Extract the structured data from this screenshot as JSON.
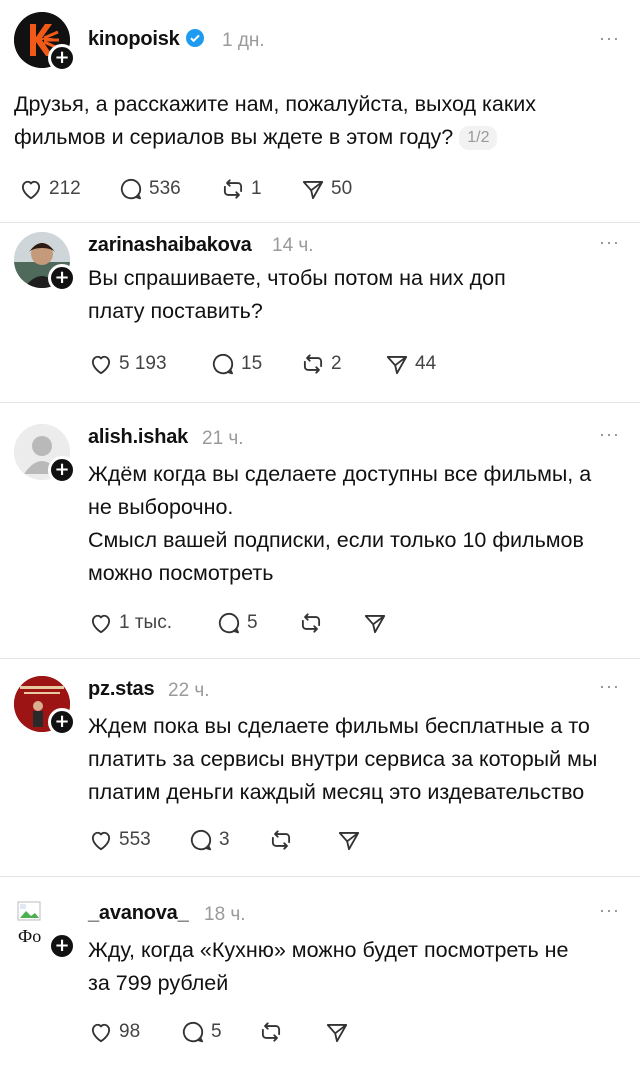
{
  "posts": [
    {
      "username": "kinopoisk",
      "verified": true,
      "time": "1 дн.",
      "text": "Друзья, а расскажите нам, пожалуйста, выход каких\nфильмов и сериалов вы ждете в этом году?",
      "pager": "1/2",
      "likes": "212",
      "replies": "536",
      "reposts": "1",
      "shares": "50"
    },
    {
      "username": "zarinashaibakova",
      "time": "14 ч.",
      "text": "Вы спрашиваете, чтобы потом на них доп\nплату поставить?",
      "likes": "5 193",
      "replies": "15",
      "reposts": "2",
      "shares": "44"
    },
    {
      "username": "alish.ishak",
      "time": "21 ч.",
      "text": "Ждём когда вы сделаете доступны все фильмы, а\nне выборочно.\nСмысл вашей подписки, если только 10 фильмов\nможно посмотреть",
      "likes": "1 тыс.",
      "replies": "5",
      "reposts": "",
      "shares": ""
    },
    {
      "username": "pz.stas",
      "time": "22 ч.",
      "text": "Ждем пока вы сделаете фильмы бесплатные а то\nплатить за сервисы внутри сервиса за который мы\nплатим деньги каждый месяц это издевательство",
      "likes": "553",
      "replies": "3",
      "reposts": "",
      "shares": ""
    },
    {
      "username": "_avanova_",
      "time": "18 ч.",
      "text": "Жду, когда «Кухню» можно будет посмотреть не\nза 799 рублей",
      "avatar_alt": "Фо",
      "likes": "98",
      "replies": "5",
      "reposts": "",
      "shares": ""
    }
  ],
  "icons": {
    "more": "more-dots-icon",
    "like": "heart-icon",
    "reply": "comment-icon",
    "repost": "repost-icon",
    "share": "send-icon",
    "follow": "plus-icon"
  },
  "colors": {
    "brand_orange": "#f05a16",
    "verified_blue": "#1d9bf0",
    "muted": "#9a9a9a"
  },
  "more_label": "···",
  "plus_label": "+"
}
